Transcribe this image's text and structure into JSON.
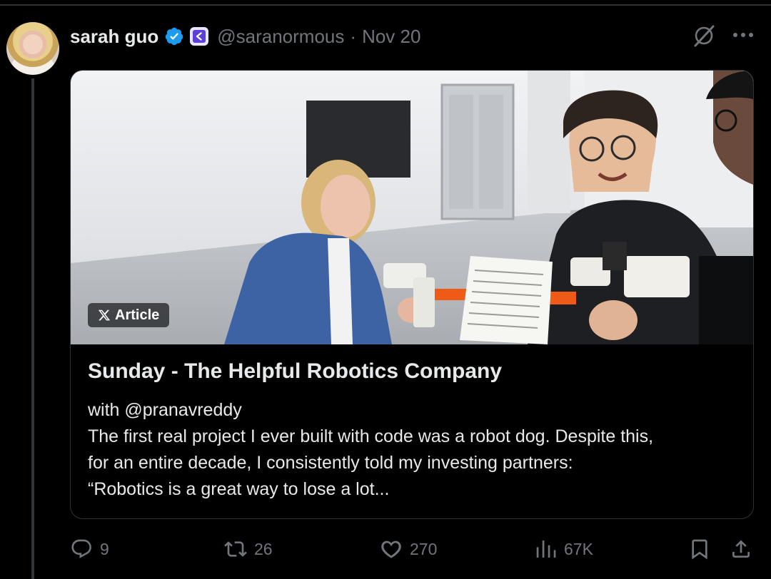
{
  "tweet": {
    "author_name": "sarah guo",
    "author_handle": "@saranormous",
    "separator": "·",
    "date": "Nov 20"
  },
  "card": {
    "badge_label": "Article",
    "title": "Sunday - The Helpful Robotics Company",
    "description_lines": [
      "with @pranavreddy",
      "The first real project I ever built with code was a robot dog. Despite this,",
      "for an entire decade, I consistently told my investing partners:",
      "“Robotics is a great way to lose a lot..."
    ]
  },
  "actions": {
    "replies": "9",
    "reposts": "26",
    "likes": "270",
    "views": "67K"
  },
  "colors": {
    "background": "#000000",
    "text": "#e7e9ea",
    "muted": "#71767b",
    "verified": "#1d9bf0",
    "border": "#2f3336"
  },
  "icons": [
    "verified-badge-icon",
    "affiliate-badge-icon",
    "grok-icon",
    "more-icon",
    "x-logo-icon",
    "reply-icon",
    "repost-icon",
    "like-icon",
    "views-icon",
    "bookmark-icon",
    "share-icon"
  ]
}
